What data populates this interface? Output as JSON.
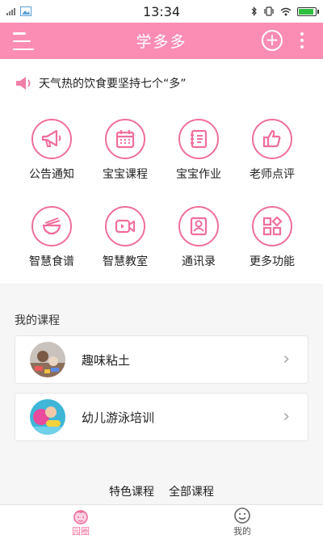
{
  "status_bar": {
    "time": "13:34"
  },
  "header": {
    "title": "学多多",
    "add_icon": "plus-circle-icon",
    "menu_icon": "menu-icon",
    "more_icon": "more-vertical-icon"
  },
  "notice": {
    "icon": "speaker-icon",
    "text": "天气热的饮食要坚持七个“多”"
  },
  "features": [
    {
      "label": "公告通知",
      "icon": "megaphone-icon"
    },
    {
      "label": "宝宝课程",
      "icon": "calendar-icon"
    },
    {
      "label": "宝宝作业",
      "icon": "notebook-icon"
    },
    {
      "label": "老师点评",
      "icon": "thumbs-up-icon"
    },
    {
      "label": "智慧食谱",
      "icon": "bowl-icon"
    },
    {
      "label": "智慧教室",
      "icon": "video-camera-icon"
    },
    {
      "label": "通讯录",
      "icon": "contacts-icon"
    },
    {
      "label": "更多功能",
      "icon": "apps-grid-icon"
    }
  ],
  "courses": {
    "title": "我的课程",
    "items": [
      {
        "name": "趣味粘土"
      },
      {
        "name": "幼儿游泳培训"
      }
    ]
  },
  "footer_links": [
    "特色课程",
    "全部课程"
  ],
  "tabs": [
    {
      "label": "园圈",
      "icon": "kid-face-icon",
      "active": true
    },
    {
      "label": "我的",
      "icon": "smiley-icon",
      "active": false
    }
  ],
  "colors": {
    "accent": "#f06e9d",
    "header": "#fb8db4"
  }
}
